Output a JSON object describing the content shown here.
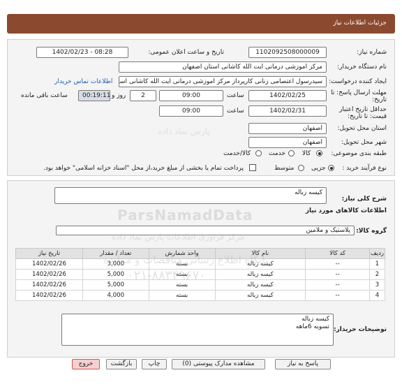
{
  "header": {
    "title": "جزئیات اطلاعات نیاز"
  },
  "fields": {
    "need_number_label": "شماره نیاز:",
    "need_number": "1102092508000009",
    "announce_label": "تاریخ و ساعت اعلان عمومی:",
    "announce_value": "1402/02/23 - 08:28",
    "buyer_org_label": "نام دستگاه خریدار:",
    "buyer_org": "مرکز اموزشی درمانی ایت الله کاشانی استان اصفهان",
    "creator_label": "ایجاد کننده درخواست:",
    "creator": "سیدرسول اعتصامی زنانی کارپرداز مرکز اموزشی درمانی ایت الله کاشانی استان",
    "contact_link": "اطلاعات تماس خریدار",
    "deadline_label_1": "مهلت ارسال پاسخ: تا",
    "deadline_label_2": "تاریخ:",
    "deadline_date": "1402/02/25",
    "time_label": "ساعت",
    "deadline_time": "09:00",
    "days_value": "2",
    "days_label": "روز و",
    "remaining_time": "00:19:11",
    "remaining_label": "ساعت باقی مانده",
    "validity_label_1": "حداقل تاریخ اعتبار",
    "validity_label_2": "قیمت: تا تاریخ:",
    "validity_date": "1402/02/31",
    "validity_time_label": "ساعت",
    "validity_time": "09:00",
    "province_label": "استان محل تحویل:",
    "province": "اصفهان",
    "city_label": "شهر محل تحویل:",
    "city": "اصفهان",
    "category_label": "طبقه بندی موضوعی:",
    "category_options": [
      "کالا",
      "خدمت",
      "کالا/خدمت"
    ],
    "category_selected": "کالا",
    "process_label": "نوع فرآیند خرید :",
    "process_options": [
      "جزیی",
      "متوسط"
    ],
    "process_selected": "جزیی",
    "payment_note": "پرداخت تمام یا بخشی از مبلغ خرید،از محل \"اسناد خزانه اسلامی\" خواهد بود."
  },
  "summary": {
    "label": "شرح کلی نیاز:",
    "value": "کیسه زباله",
    "items_title": "اطلاعات کالاهای مورد نیاز",
    "group_label": "گروه کالا:",
    "group_value": "پلاستیک و ملامین"
  },
  "table": {
    "headers": [
      "ردیف",
      "کد کالا",
      "نام کالا",
      "واحد شمارش",
      "تعداد / مقدار",
      "تاریخ نیاز"
    ],
    "rows": [
      [
        "1",
        "--",
        "کیسه زباله",
        "بسته",
        "3,000",
        "1402/02/26"
      ],
      [
        "2",
        "--",
        "کیسه زباله",
        "بسته",
        "5,000",
        "1402/02/26"
      ],
      [
        "3",
        "--",
        "کیسه زباله",
        "بسته",
        "5,000",
        "1402/02/26"
      ],
      [
        "4",
        "--",
        "کیسه زباله",
        "بسته",
        "4,000",
        "1402/02/26"
      ]
    ]
  },
  "buyer_notes": {
    "label": "توضیحات خریدار:",
    "line1": "کیسه زباله",
    "line2": "تسویه 6ماهه"
  },
  "buttons": {
    "reply": "پاسخ به نیاز",
    "view_docs": "مشاهده مدارک پیوستی (0)",
    "print": "چاپ",
    "back": "بازگشت",
    "exit": "خروج"
  },
  "watermark": {
    "brand": "ParsNamadData",
    "fa_name": "پارس نماد داده",
    "fa_sub": "مرکز فراوری اطلاعات پارس نماد داده",
    "fa_tender": "پایگاه اطلاع رسانی مناقصات و مزایده",
    "phone": "۰۲۱-۸۸۳۴۹۶۷۰"
  },
  "colors": {
    "header_bg": "#8b4a2f",
    "link": "#1a5fb4",
    "exit_button": "#f6d0d0"
  }
}
